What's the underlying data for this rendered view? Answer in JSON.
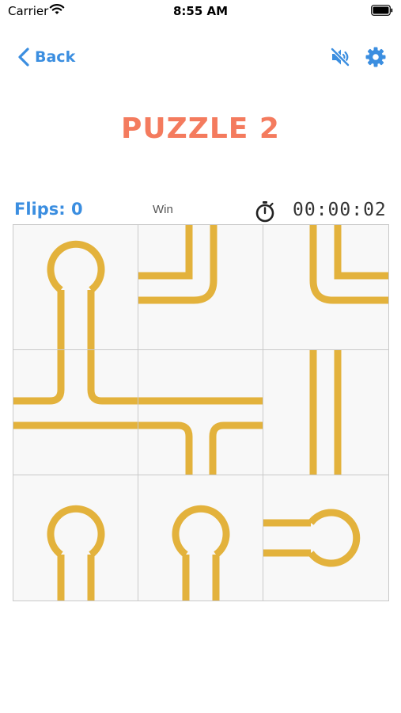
{
  "status_bar": {
    "carrier": "Carrier",
    "time": "8:55 AM"
  },
  "nav": {
    "back_label": "Back"
  },
  "title": "PUZZLE 2",
  "stats": {
    "flips_label": "Flips: 0",
    "win_label": "Win",
    "timer": "00:00:02"
  },
  "colors": {
    "accent_blue": "#3b8ee0",
    "title_coral": "#f47b5e",
    "pipe_gold": "#e3b23c",
    "tile_bg": "#f8f8f8",
    "grid_line": "#c9c9c9"
  },
  "icons": {
    "back": "chevron-left-icon",
    "mute": "speaker-muted-icon",
    "settings": "gear-icon",
    "timer": "stopwatch-icon"
  },
  "board": {
    "rows": 3,
    "cols": 3,
    "tiles": [
      {
        "row": 1,
        "col": 1,
        "piece": "endpoint"
      },
      {
        "row": 1,
        "col": 2,
        "piece": "corner"
      },
      {
        "row": 1,
        "col": 3,
        "piece": "corner"
      },
      {
        "row": 2,
        "col": 1,
        "piece": "t-junction"
      },
      {
        "row": 2,
        "col": 2,
        "piece": "t-junction"
      },
      {
        "row": 2,
        "col": 3,
        "piece": "straight"
      },
      {
        "row": 3,
        "col": 1,
        "piece": "endpoint"
      },
      {
        "row": 3,
        "col": 2,
        "piece": "endpoint"
      },
      {
        "row": 3,
        "col": 3,
        "piece": "endpoint"
      }
    ]
  }
}
